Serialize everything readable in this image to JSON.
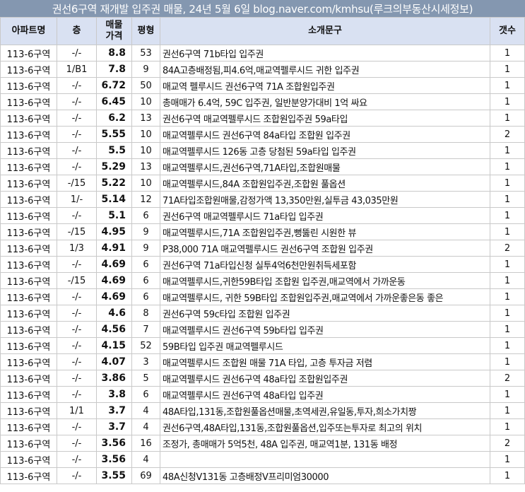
{
  "title": "권선6구역 재개발 입주권 매물, 24년 5월 6일 blog.naver.com/kmhsu(루크의부동산시세정보)",
  "headers": {
    "name": "아파트명",
    "floor": "층",
    "price_line1": "매물",
    "price_line2": "가격",
    "size": "평형",
    "desc": "소개문구",
    "count": "갯수"
  },
  "rows": [
    {
      "name": "113-6구역",
      "floor": "-/-",
      "price": "8.8",
      "size": "53",
      "desc": "권선6구역 71b타입 입주권",
      "count": "1"
    },
    {
      "name": "113-6구역",
      "floor": "1/B1",
      "price": "7.8",
      "size": "9",
      "desc": "84A고층배정됨,피4.6억,매교역펠루시드 귀한 입주권",
      "count": "1"
    },
    {
      "name": "113-6구역",
      "floor": "-/-",
      "price": "6.72",
      "size": "50",
      "desc": "매교역 펠루시드 권선6구역 71A 조합원입주권",
      "count": "1"
    },
    {
      "name": "113-6구역",
      "floor": "-/-",
      "price": "6.45",
      "size": "10",
      "desc": "총매매가 6.4억, 59C 입주권, 일반분양가대비 1억 싸요",
      "count": "1"
    },
    {
      "name": "113-6구역",
      "floor": "-/-",
      "price": "6.2",
      "size": "13",
      "desc": "권선6구역 매교역펠루시드 조합원입주권 59a타입",
      "count": "1"
    },
    {
      "name": "113-6구역",
      "floor": "-/-",
      "price": "5.55",
      "size": "10",
      "desc": "매교역펠루시드 권선6구역 84a타입 조합원 입주권",
      "count": "2"
    },
    {
      "name": "113-6구역",
      "floor": "-/-",
      "price": "5.5",
      "size": "10",
      "desc": "매교역펠루시드 126동 고층 당첨된 59a타입 입주권",
      "count": "1"
    },
    {
      "name": "113-6구역",
      "floor": "-/-",
      "price": "5.29",
      "size": "13",
      "desc": "매교역펠루시드,권선6구역,71A타입,조합원매물",
      "count": "1"
    },
    {
      "name": "113-6구역",
      "floor": "-/15",
      "price": "5.22",
      "size": "10",
      "desc": "매교역펠루시드,84A 조합원입주권,조합원 풀옵션",
      "count": "1"
    },
    {
      "name": "113-6구역",
      "floor": "1/-",
      "price": "5.14",
      "size": "12",
      "desc": "71A타입조합원매물,감정가액 13,350만원,실투금 43,035만원",
      "count": "1"
    },
    {
      "name": "113-6구역",
      "floor": "-/-",
      "price": "5.1",
      "size": "6",
      "desc": "권선6구역 매교역펠루시드 71a타입 입주권",
      "count": "1"
    },
    {
      "name": "113-6구역",
      "floor": "-/15",
      "price": "4.95",
      "size": "9",
      "desc": "매교역펠루시드,71A 조합원입주권,뻥뚫린 시원한 뷰",
      "count": "1"
    },
    {
      "name": "113-6구역",
      "floor": "1/3",
      "price": "4.91",
      "size": "9",
      "desc": "P38,000 71A 매교역펠루시드 권선6구역 조합원 입주권",
      "count": "2"
    },
    {
      "name": "113-6구역",
      "floor": "-/-",
      "price": "4.69",
      "size": "6",
      "desc": "권선6구역 71a타입신청 실투4억6천만원취득세포함",
      "count": "1"
    },
    {
      "name": "113-6구역",
      "floor": "-/15",
      "price": "4.69",
      "size": "6",
      "desc": "매교역펠루시드,귀한59B타입 조합원 입주권,매교역에서 가까운동",
      "count": "1"
    },
    {
      "name": "113-6구역",
      "floor": "-/-",
      "price": "4.69",
      "size": "6",
      "desc": "매교역펠루시드, 귀한 59B타입 조합원입주권,매교역에서 가까운좋은동 좋은",
      "count": "1"
    },
    {
      "name": "113-6구역",
      "floor": "-/-",
      "price": "4.6",
      "size": "8",
      "desc": "권선6구역 59c타입 조합원 입주권",
      "count": "1"
    },
    {
      "name": "113-6구역",
      "floor": "-/-",
      "price": "4.56",
      "size": "7",
      "desc": "매교역펠루시드 권선6구역 59b타입 입주권",
      "count": "1"
    },
    {
      "name": "113-6구역",
      "floor": "-/-",
      "price": "4.15",
      "size": "52",
      "desc": "59B타입 입주권 매교역펠루시드",
      "count": "1"
    },
    {
      "name": "113-6구역",
      "floor": "-/-",
      "price": "4.07",
      "size": "3",
      "desc": "매교역펠루시드 조합원 매물 71A 타입, 고층 투자금 저렴",
      "count": "1"
    },
    {
      "name": "113-6구역",
      "floor": "-/-",
      "price": "3.86",
      "size": "5",
      "desc": "매교역펠루시드 권선6구역 48a타입 조합원입주권",
      "count": "2"
    },
    {
      "name": "113-6구역",
      "floor": "-/-",
      "price": "3.8",
      "size": "6",
      "desc": "매교역펠루시드 권선6구역 48a타입 입주권",
      "count": "1"
    },
    {
      "name": "113-6구역",
      "floor": "1/1",
      "price": "3.7",
      "size": "4",
      "desc": "48A타입,131동,조합원풀옵션매물,초역세권,유일동,투자,희소가치짱",
      "count": "1"
    },
    {
      "name": "113-6구역",
      "floor": "-/-",
      "price": "3.7",
      "size": "4",
      "desc": "권선6구역,48A타입,131동,조합원풀옵션,입주또는투자로 최고의 위치",
      "count": "1"
    },
    {
      "name": "113-6구역",
      "floor": "-/-",
      "price": "3.56",
      "size": "16",
      "desc": "조정가, 총매매가 5억5천, 48A 입주권, 매교역1분, 131동 배정",
      "count": "2"
    },
    {
      "name": "113-6구역",
      "floor": "-/-",
      "price": "3.56",
      "size": "4",
      "desc": "",
      "count": "1"
    },
    {
      "name": "113-6구역",
      "floor": "-/-",
      "price": "3.55",
      "size": "69",
      "desc": "48A신청V131동 고층배정V프리미엄30000",
      "count": "1"
    }
  ]
}
